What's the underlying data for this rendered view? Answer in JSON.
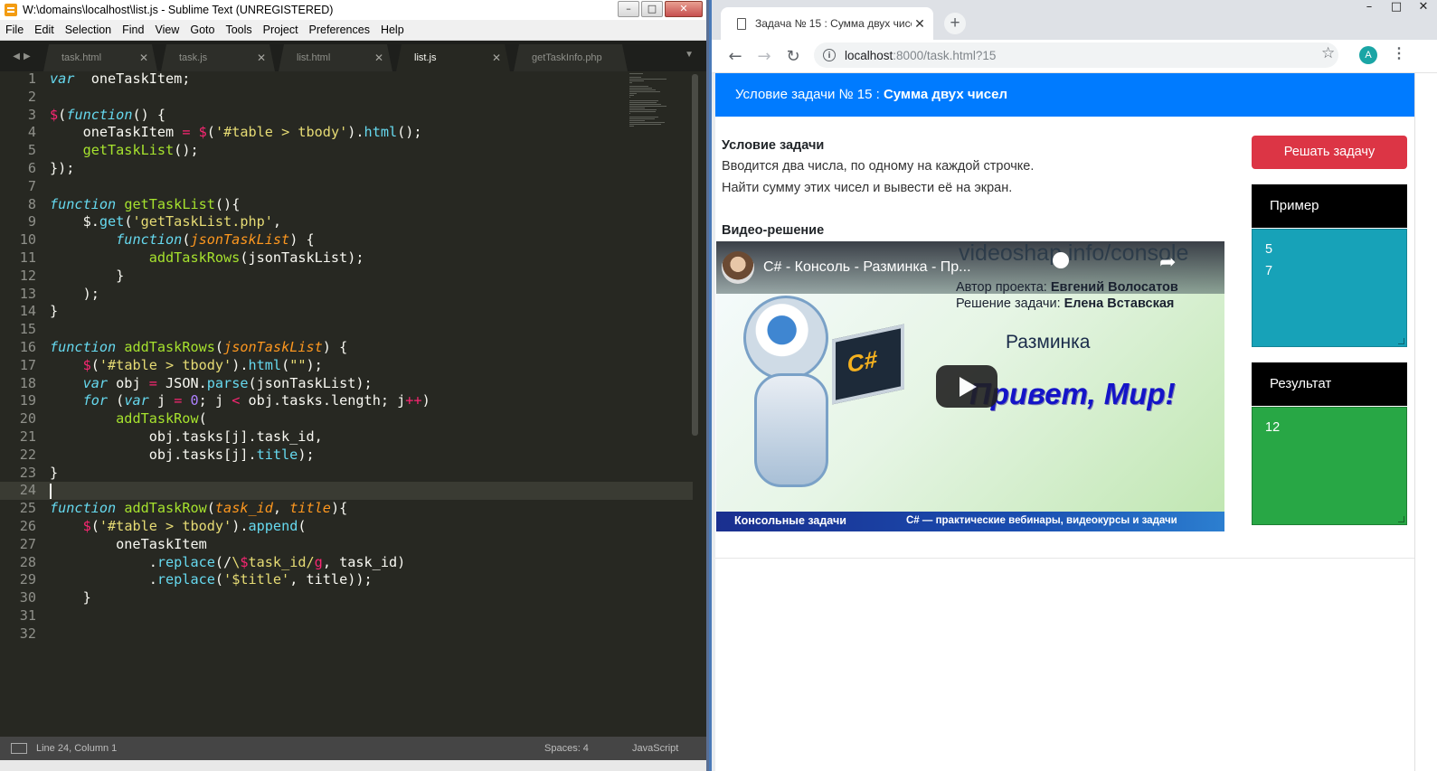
{
  "sublime": {
    "title": "W:\\domains\\localhost\\list.js - Sublime Text (UNREGISTERED)",
    "menu": [
      "File",
      "Edit",
      "Selection",
      "Find",
      "View",
      "Goto",
      "Tools",
      "Project",
      "Preferences",
      "Help"
    ],
    "tabs": [
      {
        "label": "task.html",
        "active": false
      },
      {
        "label": "task.js",
        "active": false
      },
      {
        "label": "list.html",
        "active": false
      },
      {
        "label": "list.js",
        "active": true
      },
      {
        "label": "getTaskInfo.php",
        "active": false
      }
    ],
    "line_numbers": [
      "1",
      "2",
      "3",
      "4",
      "5",
      "6",
      "7",
      "8",
      "9",
      "10",
      "11",
      "12",
      "13",
      "14",
      "15",
      "16",
      "17",
      "18",
      "19",
      "20",
      "21",
      "22",
      "23",
      "24",
      "25",
      "26",
      "27",
      "28",
      "29",
      "30",
      "31",
      "32"
    ],
    "code": [
      [
        [
          "kw",
          "var"
        ],
        [
          "",
          "  oneTaskItem;"
        ]
      ],
      [],
      [
        [
          "op",
          "$"
        ],
        [
          "",
          "("
        ],
        [
          "kw",
          "function"
        ],
        [
          "",
          "() {"
        ]
      ],
      [
        [
          "",
          "    oneTaskItem "
        ],
        [
          "op",
          "="
        ],
        [
          "",
          " "
        ],
        [
          "op",
          "$"
        ],
        [
          "",
          "("
        ],
        [
          "st",
          "'#table > tbody'"
        ],
        [
          "",
          ")."
        ],
        [
          "mt",
          "html"
        ],
        [
          "",
          "();"
        ]
      ],
      [
        [
          "",
          "    "
        ],
        [
          "fn",
          "getTaskList"
        ],
        [
          "",
          "();"
        ]
      ],
      [
        [
          "",
          "});"
        ]
      ],
      [],
      [
        [
          "kw",
          "function"
        ],
        [
          "",
          " "
        ],
        [
          "fn",
          "getTaskList"
        ],
        [
          "",
          "(){"
        ]
      ],
      [
        [
          "",
          "    $."
        ],
        [
          "mt",
          "get"
        ],
        [
          "",
          "("
        ],
        [
          "st",
          "'getTaskList.php'"
        ],
        [
          "",
          ","
        ]
      ],
      [
        [
          "",
          "        "
        ],
        [
          "kw",
          "function"
        ],
        [
          "",
          "("
        ],
        [
          "pm",
          "jsonTaskList"
        ],
        [
          "",
          ") {"
        ]
      ],
      [
        [
          "",
          "            "
        ],
        [
          "fn",
          "addTaskRows"
        ],
        [
          "",
          "(jsonTaskList);"
        ]
      ],
      [
        [
          "",
          "        }"
        ]
      ],
      [
        [
          "",
          "    );"
        ]
      ],
      [
        [
          "",
          "}"
        ]
      ],
      [],
      [
        [
          "kw",
          "function"
        ],
        [
          "",
          " "
        ],
        [
          "fn",
          "addTaskRows"
        ],
        [
          "",
          "("
        ],
        [
          "pm",
          "jsonTaskList"
        ],
        [
          "",
          ") {"
        ]
      ],
      [
        [
          "",
          "    "
        ],
        [
          "op",
          "$"
        ],
        [
          "",
          "("
        ],
        [
          "st",
          "'#table > tbody'"
        ],
        [
          "",
          ")."
        ],
        [
          "mt",
          "html"
        ],
        [
          "",
          "("
        ],
        [
          "st",
          "\"\""
        ],
        [
          "",
          ");"
        ]
      ],
      [
        [
          "",
          "    "
        ],
        [
          "kw",
          "var"
        ],
        [
          "",
          " obj "
        ],
        [
          "op",
          "="
        ],
        [
          "",
          " JSON."
        ],
        [
          "mt",
          "parse"
        ],
        [
          "",
          "(jsonTaskList);"
        ]
      ],
      [
        [
          "",
          "    "
        ],
        [
          "kw",
          "for"
        ],
        [
          "",
          " ("
        ],
        [
          "kw",
          "var"
        ],
        [
          "",
          " j "
        ],
        [
          "op",
          "="
        ],
        [
          "",
          " "
        ],
        [
          "nm",
          "0"
        ],
        [
          "",
          "; j "
        ],
        [
          "op",
          "<"
        ],
        [
          "",
          " obj.tasks.length; j"
        ],
        [
          "op",
          "++"
        ],
        [
          "",
          ")"
        ]
      ],
      [
        [
          "",
          "        "
        ],
        [
          "fn",
          "addTaskRow"
        ],
        [
          "",
          "("
        ]
      ],
      [
        [
          "",
          "            obj.tasks[j].task_id,"
        ]
      ],
      [
        [
          "",
          "            obj.tasks[j]."
        ],
        [
          "mt",
          "title"
        ],
        [
          "",
          ");"
        ]
      ],
      [
        [
          "",
          "}"
        ]
      ],
      [],
      [
        [
          "kw",
          "function"
        ],
        [
          "",
          " "
        ],
        [
          "fn",
          "addTaskRow"
        ],
        [
          "",
          "("
        ],
        [
          "pm",
          "task_id"
        ],
        [
          "",
          ", "
        ],
        [
          "pm",
          "title"
        ],
        [
          "",
          "){"
        ]
      ],
      [
        [
          "",
          "    "
        ],
        [
          "op",
          "$"
        ],
        [
          "",
          "("
        ],
        [
          "st",
          "'#table > tbody'"
        ],
        [
          "",
          ")."
        ],
        [
          "mt",
          "append"
        ],
        [
          "",
          "("
        ]
      ],
      [
        [
          "",
          "        oneTaskItem"
        ]
      ],
      [
        [
          "",
          "            ."
        ],
        [
          "mt",
          "replace"
        ],
        [
          "",
          "(/"
        ],
        [
          "st",
          "\\"
        ],
        [
          "op",
          "$"
        ],
        [
          "st",
          "task_id/"
        ],
        [
          "op",
          "g"
        ],
        [
          "",
          ", task_id)"
        ]
      ],
      [
        [
          "",
          "            ."
        ],
        [
          "mt",
          "replace"
        ],
        [
          "",
          "("
        ],
        [
          "st",
          "'$title'"
        ],
        [
          "",
          ", title));"
        ]
      ],
      [
        [
          "",
          "    }"
        ]
      ],
      [],
      []
    ],
    "status": {
      "position": "Line 24, Column 1",
      "spaces": "Spaces: 4",
      "syntax": "JavaScript"
    }
  },
  "chrome": {
    "tab_title": "Задача № 15 : Сумма двух чисе",
    "url_host": "localhost",
    "url_rest": ":8000/task.html?15",
    "avatar_letter": "A"
  },
  "page": {
    "header_prefix": "Условие задачи № 15 : ",
    "header_title": "Сумма двух чисел",
    "condition_title": "Условие задачи",
    "condition_line1": "Вводится два числа, по одному на каждой строчке.",
    "condition_line2": "Найти сумму этих чисел и вывести её на экран.",
    "video_title": "Видео-решение",
    "video": {
      "title": "C# - Консоль - Разминка - Пр...",
      "site": "videoshap.info/console",
      "author_label": "Автор проекта:",
      "author_name": "Евгений Волосатов",
      "solution_label": "Решение задачи:",
      "solution_name": "Елена Вставская",
      "laptop_label": "C#",
      "razminka": "Разминка",
      "hello": "Привет, Мир!",
      "bottom_left": "Консольные задачи",
      "bottom_right": "C# — практические вебинары, видеокурсы и задачи"
    },
    "solve_button": "Решать задачу",
    "example_title": "Пример",
    "example_lines": [
      "5",
      "7"
    ],
    "result_title": "Результат",
    "result_lines": [
      "12"
    ]
  }
}
